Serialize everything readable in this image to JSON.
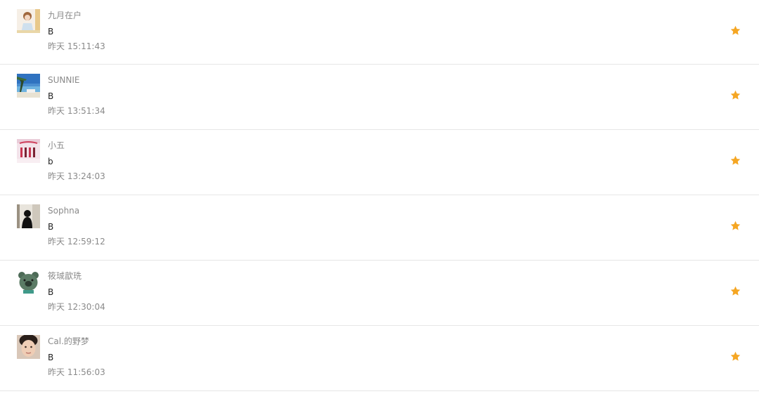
{
  "accent_color": "#f5a623",
  "messages": [
    {
      "name": "九月在户",
      "text": "B",
      "time": "昨天 15:11:43",
      "starred": true,
      "avatar_icon": "girl-illustration-avatar"
    },
    {
      "name": "SUNNIE",
      "text": "B",
      "time": "昨天 13:51:34",
      "starred": true,
      "avatar_icon": "beach-photo-avatar"
    },
    {
      "name": "小五",
      "text": "b",
      "time": "昨天 13:24:03",
      "starred": true,
      "avatar_icon": "pink-photo-avatar"
    },
    {
      "name": "Sophna",
      "text": "B",
      "time": "昨天 12:59:12",
      "starred": true,
      "avatar_icon": "silhouette-photo-avatar"
    },
    {
      "name": "筱珹歆珗",
      "text": "B",
      "time": "昨天 12:30:04",
      "starred": true,
      "avatar_icon": "green-creature-avatar"
    },
    {
      "name": "Cal.的野梦",
      "text": "B",
      "time": "昨天 11:56:03",
      "starred": true,
      "avatar_icon": "face-photo-avatar"
    }
  ]
}
